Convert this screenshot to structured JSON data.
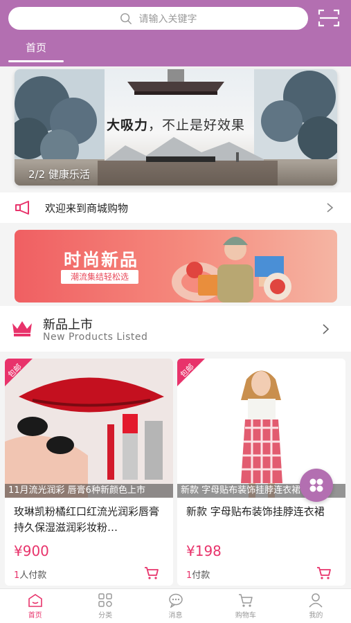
{
  "search": {
    "placeholder": "请输入关键字"
  },
  "top_tabs": [
    {
      "label": "首页"
    }
  ],
  "banner": {
    "headline_bold": "大吸力",
    "headline_rest": "，不止是好效果",
    "counter": "2/2",
    "caption": "健康乐活"
  },
  "notice": {
    "text": "欢迎来到商城购物"
  },
  "promo": {
    "title": "时尚新品",
    "subtitle": "潮流集结轻松选"
  },
  "section": {
    "title": "新品上市",
    "subtitle": "New Products Listed"
  },
  "products": [
    {
      "badge": "包邮",
      "caption": "11月流光润彩 唇膏6种新颜色上市",
      "name": "玫琳凯粉橘红口红流光润彩唇膏持久保湿滋润彩妆粉…",
      "price": "¥900",
      "sold_count": "1",
      "sold_label": "人付款"
    },
    {
      "badge": "包邮",
      "caption": "新款 字母贴布装饰挂脖连衣裙",
      "name": "新款 字母贴布装饰挂脖连衣裙",
      "price": "¥198",
      "sold_count": "1",
      "sold_label": "付款"
    }
  ],
  "tabbar": [
    {
      "label": "首页",
      "icon": "home-icon",
      "active": true
    },
    {
      "label": "分类",
      "icon": "category-icon",
      "active": false
    },
    {
      "label": "消息",
      "icon": "message-icon",
      "active": false
    },
    {
      "label": "购物车",
      "icon": "cart-icon",
      "active": false
    },
    {
      "label": "我的",
      "icon": "user-icon",
      "active": false
    }
  ],
  "colors": {
    "header": "#b36fb1",
    "accent": "#e8336b"
  }
}
